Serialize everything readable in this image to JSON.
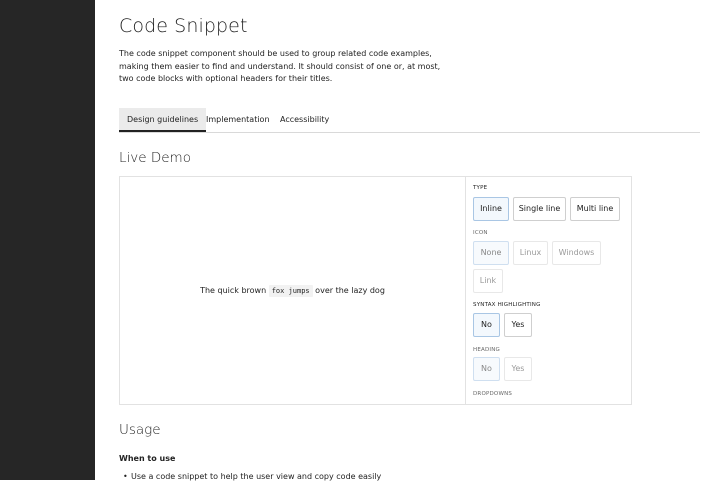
{
  "page": {
    "title": "Code Snippet",
    "intro": "The code snippet component should be used to group related code examples, making them easier to find and understand. It should consist of one or, at most, two code blocks with optional headers for their titles."
  },
  "tabs": [
    {
      "label": "Design guidelines",
      "active": true
    },
    {
      "label": "Implementation",
      "active": false
    },
    {
      "label": "Accessibility",
      "active": false
    }
  ],
  "live_demo": {
    "title": "Live Demo",
    "preview": {
      "before": "The quick brown ",
      "code": "fox jumps",
      "after": " over the lazy dog"
    },
    "controls": {
      "type": {
        "label": "TYPE",
        "options": [
          "Inline",
          "Single line",
          "Multi line"
        ],
        "selected": "Inline"
      },
      "icon": {
        "label": "ICON",
        "options": [
          "None",
          "Linux",
          "Windows",
          "Link"
        ],
        "selected": "None",
        "disabled": true
      },
      "syntax": {
        "label": "SYNTAX HIGHLIGHTING",
        "options": [
          "No",
          "Yes"
        ],
        "selected": "No"
      },
      "heading": {
        "label": "HEADING",
        "options": [
          "No",
          "Yes"
        ],
        "selected": "No",
        "disabled": true
      },
      "dropdowns": {
        "label": "DROPDOWNS"
      }
    }
  },
  "usage": {
    "title": "Usage",
    "when_to_use": "When to use",
    "items": [
      "Use a code snippet to help the user view and copy code easily"
    ]
  },
  "colors": {
    "sidebar": "#262626",
    "selected_border": "#a9c6e4",
    "tab_active_bg": "#ebebeb"
  }
}
